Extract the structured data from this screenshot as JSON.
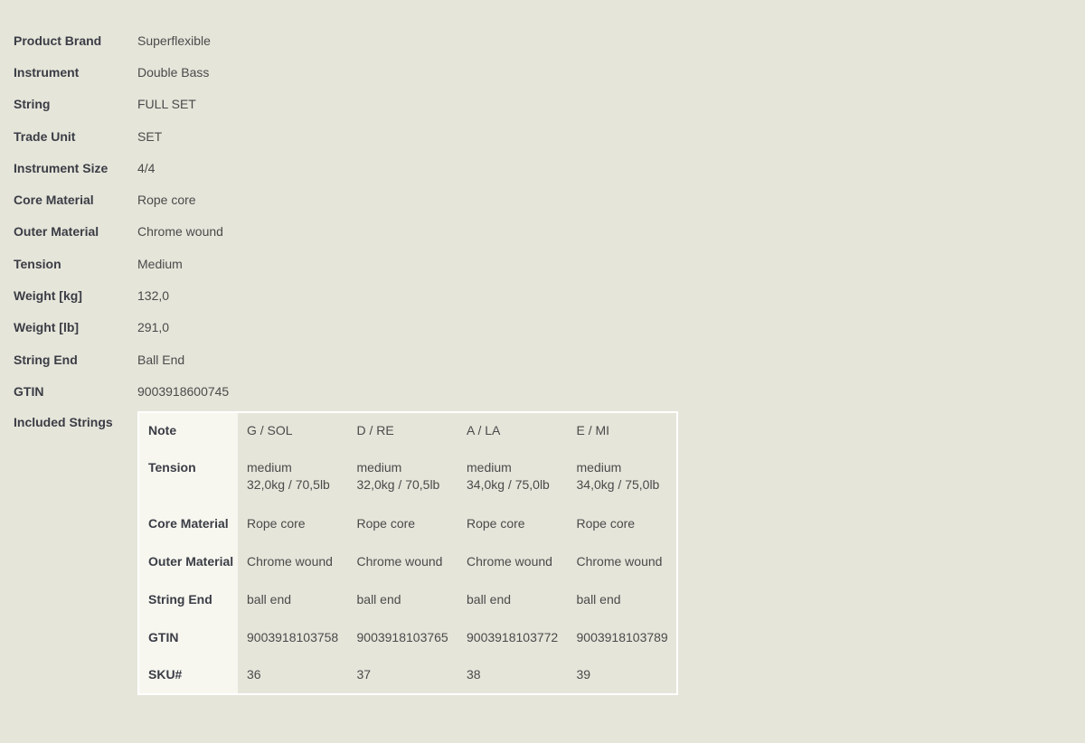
{
  "specs": [
    {
      "label": "Product Brand",
      "value": "Superflexible"
    },
    {
      "label": "Instrument",
      "value": "Double Bass"
    },
    {
      "label": "String",
      "value": "FULL SET"
    },
    {
      "label": "Trade Unit",
      "value": "SET"
    },
    {
      "label": "Instrument Size",
      "value": "4/4"
    },
    {
      "label": "Core Material",
      "value": "Rope core"
    },
    {
      "label": "Outer Material",
      "value": "Chrome wound"
    },
    {
      "label": "Tension",
      "value": "Medium"
    },
    {
      "label": "Weight [kg]",
      "value": "132,0"
    },
    {
      "label": "Weight [lb]",
      "value": "291,0"
    },
    {
      "label": "String End",
      "value": "Ball End"
    },
    {
      "label": "GTIN",
      "value": "9003918600745"
    }
  ],
  "included": {
    "label": "Included Strings",
    "row_labels": {
      "note": "Note",
      "tension": "Tension",
      "core": "Core Material",
      "outer": "Outer Material",
      "end": "String End",
      "gtin": "GTIN",
      "sku": "SKU#"
    },
    "strings": [
      {
        "note": "G / SOL",
        "tension_1": "medium",
        "tension_2": "32,0kg / 70,5lb",
        "core": "Rope core",
        "outer": "Chrome wound",
        "end": "ball end",
        "gtin": "9003918103758",
        "sku": "36"
      },
      {
        "note": "D / RE",
        "tension_1": "medium",
        "tension_2": "32,0kg / 70,5lb",
        "core": "Rope core",
        "outer": "Chrome wound",
        "end": "ball end",
        "gtin": "9003918103765",
        "sku": "37"
      },
      {
        "note": "A / LA",
        "tension_1": "medium",
        "tension_2": "34,0kg / 75,0lb",
        "core": "Rope core",
        "outer": "Chrome wound",
        "end": "ball end",
        "gtin": "9003918103772",
        "sku": "38"
      },
      {
        "note": "E / MI",
        "tension_1": "medium",
        "tension_2": "34,0kg / 75,0lb",
        "core": "Rope core",
        "outer": "Chrome wound",
        "end": "ball end",
        "gtin": "9003918103789",
        "sku": "39"
      }
    ]
  }
}
